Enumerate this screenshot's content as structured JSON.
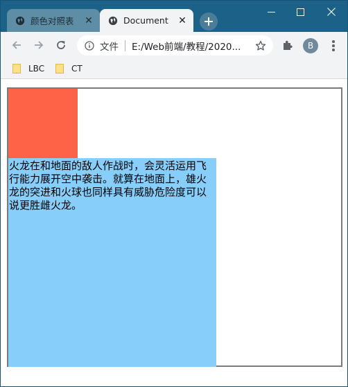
{
  "browser": {
    "tabs": [
      {
        "title": "颜色对照表"
      },
      {
        "title": "Document"
      }
    ],
    "address_bar": {
      "security_label": "文件",
      "url": "E:/Web前端/教程/2020..."
    },
    "profile_initial": "B",
    "bookmarks": [
      {
        "label": "LBC"
      },
      {
        "label": "CT"
      }
    ]
  },
  "page": {
    "paragraph": "火龙在和地面的敌人作战时，会灵活运用飞行能力展开空中袭击。就算在地面上，雄火龙的突进和火球也同样具有威胁危险度可以说更胜雌火龙。"
  },
  "colors": {
    "titlebar": "#1c6288",
    "red_box": "#ff6347",
    "blue_box": "#87cefa",
    "outer_border": "#7a7a7a"
  }
}
